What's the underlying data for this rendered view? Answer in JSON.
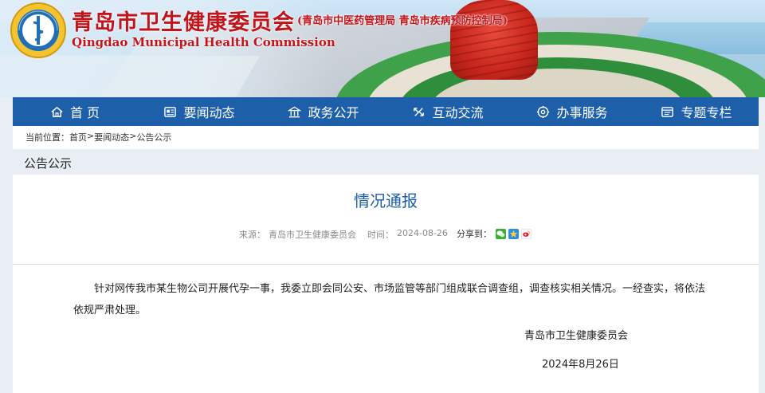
{
  "header": {
    "title_cn": "青岛市卫生健康委员会",
    "subtitle_cn": "(青岛市中医药管理局 青岛市疾病预防控制局)",
    "title_en": "Qingdao Municipal Health Commission",
    "logo_icon": "health-commission-emblem-icon"
  },
  "nav": {
    "items": [
      {
        "label": "首 页",
        "icon": "home-icon"
      },
      {
        "label": "要闻动态",
        "icon": "news-icon"
      },
      {
        "label": "政务公开",
        "icon": "building-icon"
      },
      {
        "label": "互动交流",
        "icon": "interaction-icon"
      },
      {
        "label": "办事服务",
        "icon": "service-icon"
      },
      {
        "label": "专题专栏",
        "icon": "topic-icon"
      }
    ]
  },
  "breadcrumb": {
    "prefix": "当前位置：",
    "items": [
      "首页",
      "要闻动态",
      "公告公示"
    ],
    "separator": ">"
  },
  "section": {
    "title": "公告公示"
  },
  "article": {
    "title": "情况通报",
    "source_label": "来源：",
    "source": "青岛市卫生健康委员会",
    "time_label": "时间：",
    "time": "2024-08-26",
    "share_label": "分享到：",
    "share_targets": [
      "wechat-share-icon",
      "qzone-share-icon",
      "weibo-share-icon"
    ],
    "body": "针对网传我市某生物公司开展代孕一事，我委立即会同公安、市场监管等部门组成联合调查组，调查核实相关情况。一经查实，将依法依规严肃处理。",
    "sign_org": "青岛市卫生健康委员会",
    "sign_date": "2024年8月26日"
  },
  "colors": {
    "nav_bg": "#1d5fa8",
    "title_red": "#c2141b",
    "article_title": "#1d5fa8",
    "page_bg": "#e9eef5"
  }
}
